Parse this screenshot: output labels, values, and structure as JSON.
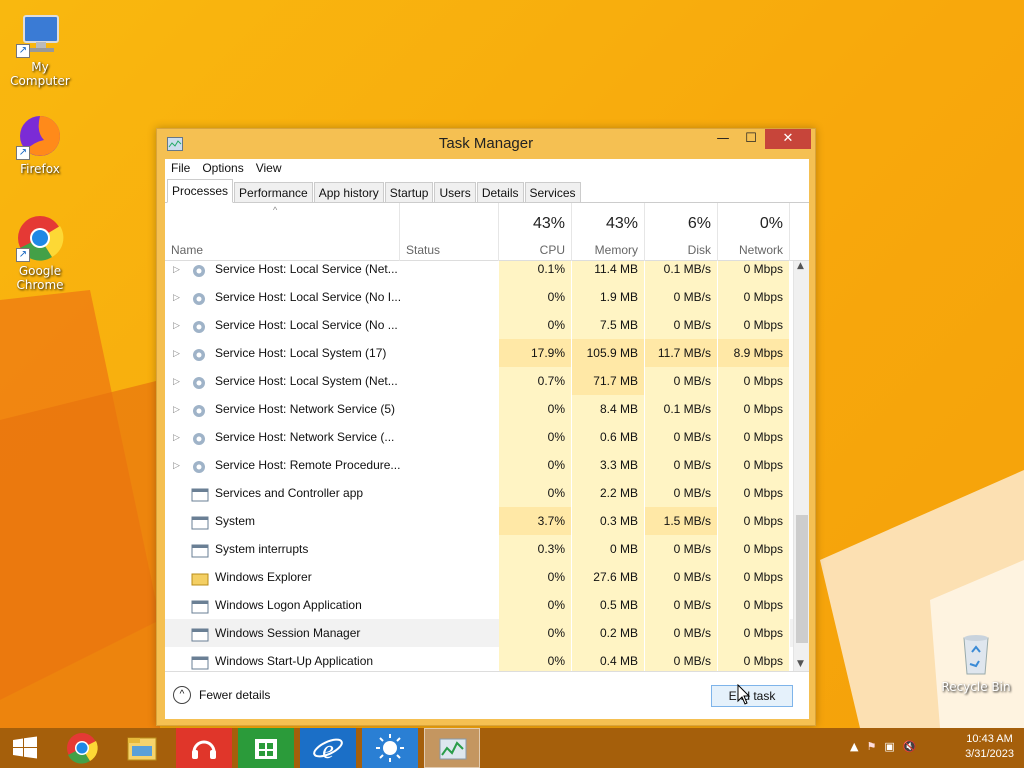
{
  "desktop": {
    "icons": [
      {
        "label": "My Computer",
        "icon": "computer-icon"
      },
      {
        "label": "Firefox",
        "icon": "firefox-icon"
      },
      {
        "label": "Google Chrome",
        "icon": "chrome-icon"
      },
      {
        "label": "Recycle Bin",
        "icon": "recycle-bin-icon"
      }
    ]
  },
  "window": {
    "title": "Task Manager",
    "controls": {
      "minimize": "—",
      "maximize": "☐",
      "close": "✕"
    },
    "menu": [
      "File",
      "Options",
      "View"
    ],
    "tabs": [
      "Processes",
      "Performance",
      "App history",
      "Startup",
      "Users",
      "Details",
      "Services"
    ],
    "active_tab": "Processes",
    "columns": {
      "name": "Name",
      "status": "Status",
      "cpu": {
        "pct": "43%",
        "label": "CPU"
      },
      "memory": {
        "pct": "43%",
        "label": "Memory"
      },
      "disk": {
        "pct": "6%",
        "label": "Disk"
      },
      "network": {
        "pct": "0%",
        "label": "Network"
      }
    },
    "rows": [
      {
        "name": "Service Host: Local Service (Net...",
        "cpu": "0.1%",
        "mem": "11.4 MB",
        "disk": "0.1 MB/s",
        "net": "0 Mbps",
        "expand": true,
        "icon": "gear-icon"
      },
      {
        "name": "Service Host: Local Service (No I...",
        "cpu": "0%",
        "mem": "1.9 MB",
        "disk": "0 MB/s",
        "net": "0 Mbps",
        "expand": true,
        "icon": "gear-icon"
      },
      {
        "name": "Service Host: Local Service (No ...",
        "cpu": "0%",
        "mem": "7.5 MB",
        "disk": "0 MB/s",
        "net": "0 Mbps",
        "expand": true,
        "icon": "gear-icon"
      },
      {
        "name": "Service Host: Local System (17)",
        "cpu": "17.9%",
        "mem": "105.9 MB",
        "disk": "11.7 MB/s",
        "net": "8.9 Mbps",
        "expand": true,
        "icon": "gear-icon"
      },
      {
        "name": "Service Host: Local System (Net...",
        "cpu": "0.7%",
        "mem": "71.7 MB",
        "disk": "0 MB/s",
        "net": "0 Mbps",
        "expand": true,
        "icon": "gear-icon"
      },
      {
        "name": "Service Host: Network Service (5)",
        "cpu": "0%",
        "mem": "8.4 MB",
        "disk": "0.1 MB/s",
        "net": "0 Mbps",
        "expand": true,
        "icon": "gear-icon"
      },
      {
        "name": "Service Host: Network Service (...",
        "cpu": "0%",
        "mem": "0.6 MB",
        "disk": "0 MB/s",
        "net": "0 Mbps",
        "expand": true,
        "icon": "gear-icon"
      },
      {
        "name": "Service Host: Remote Procedure...",
        "cpu": "0%",
        "mem": "3.3 MB",
        "disk": "0 MB/s",
        "net": "0 Mbps",
        "expand": true,
        "icon": "gear-icon"
      },
      {
        "name": "Services and Controller app",
        "cpu": "0%",
        "mem": "2.2 MB",
        "disk": "0 MB/s",
        "net": "0 Mbps",
        "expand": false,
        "icon": "app-window-icon"
      },
      {
        "name": "System",
        "cpu": "3.7%",
        "mem": "0.3 MB",
        "disk": "1.5 MB/s",
        "net": "0 Mbps",
        "expand": false,
        "icon": "app-window-icon"
      },
      {
        "name": "System interrupts",
        "cpu": "0.3%",
        "mem": "0 MB",
        "disk": "0 MB/s",
        "net": "0 Mbps",
        "expand": false,
        "icon": "app-window-icon"
      },
      {
        "name": "Windows Explorer",
        "cpu": "0%",
        "mem": "27.6 MB",
        "disk": "0 MB/s",
        "net": "0 Mbps",
        "expand": false,
        "icon": "folder-icon"
      },
      {
        "name": "Windows Logon Application",
        "cpu": "0%",
        "mem": "0.5 MB",
        "disk": "0 MB/s",
        "net": "0 Mbps",
        "expand": false,
        "icon": "app-window-icon"
      },
      {
        "name": "Windows Session Manager",
        "cpu": "0%",
        "mem": "0.2 MB",
        "disk": "0 MB/s",
        "net": "0 Mbps",
        "expand": false,
        "icon": "app-window-icon",
        "selected": true
      },
      {
        "name": "Windows Start-Up Application",
        "cpu": "0%",
        "mem": "0.4 MB",
        "disk": "0 MB/s",
        "net": "0 Mbps",
        "expand": false,
        "icon": "app-window-icon"
      }
    ],
    "footer": {
      "fewer_details": "Fewer details",
      "end_task": "End task"
    }
  },
  "taskbar": {
    "items": [
      "start-icon",
      "chrome-icon",
      "file-explorer-icon",
      "headphones-app-icon",
      "store-icon",
      "internet-explorer-icon",
      "weather-app-icon",
      "task-manager-icon"
    ],
    "active": "task-manager-icon",
    "tray": {
      "time": "10:43 AM",
      "date": "3/31/2023"
    }
  },
  "colors": {
    "taskbar": "#a55f0b",
    "window_frame": "#f5c052",
    "close_button": "#c7453a",
    "heat": "#fff4c4"
  }
}
